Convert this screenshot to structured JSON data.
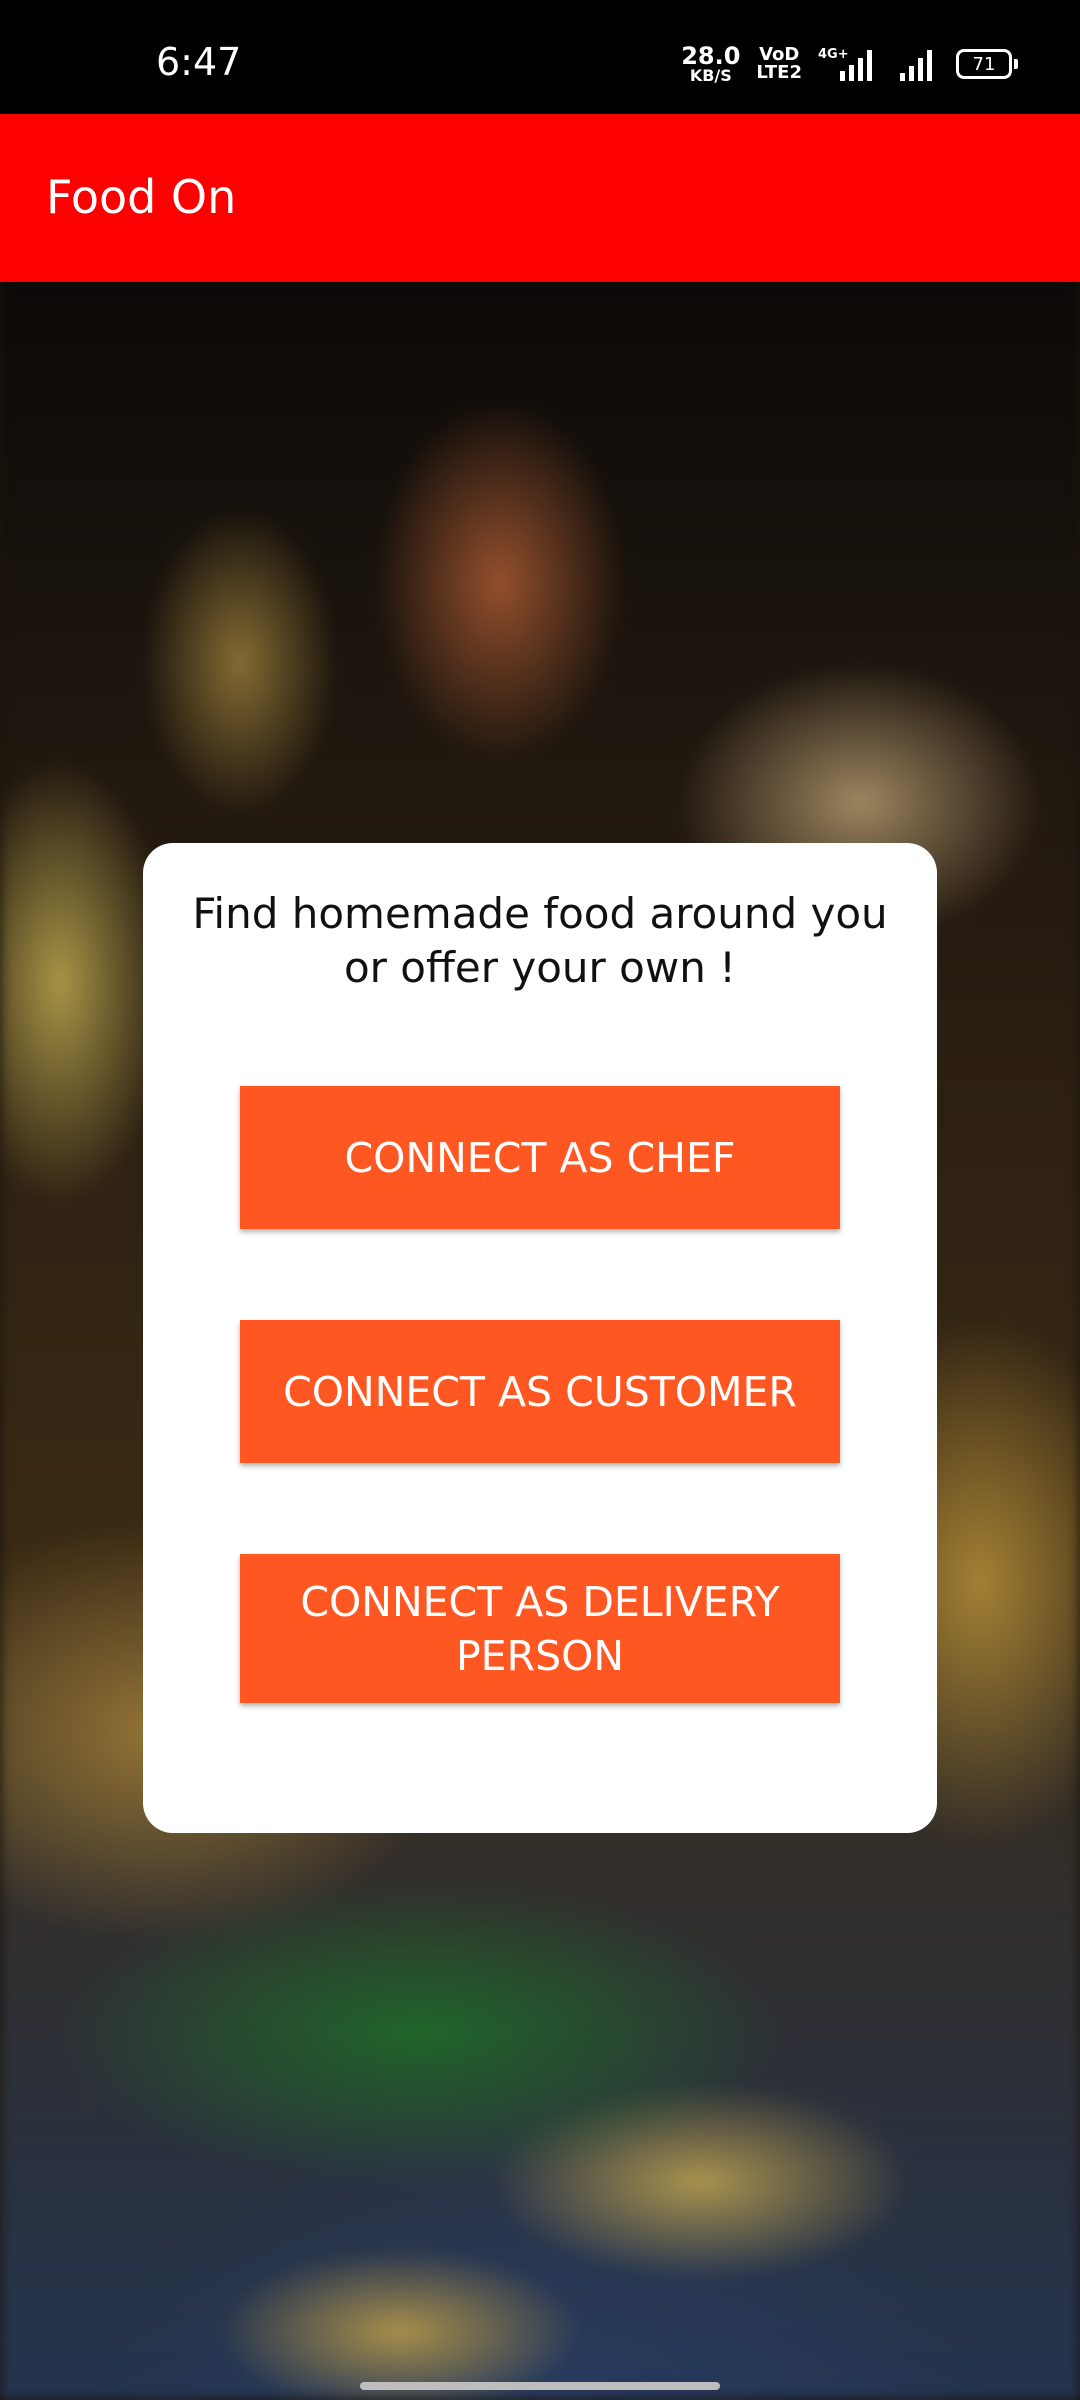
{
  "status_bar": {
    "time": "6:47",
    "net_speed_value": "28.0",
    "net_speed_unit": "KB/S",
    "volte_top": "VoD",
    "volte_bottom": "LTE2",
    "network_type": "4G+",
    "battery_level": "71"
  },
  "app_bar": {
    "title": "Food On"
  },
  "card": {
    "heading_line1": "Find homemade food around you",
    "heading_line2": "or offer your own !"
  },
  "buttons": {
    "chef_label": "CONNECT AS CHEF",
    "customer_label": "CONNECT AS CUSTOMER",
    "delivery_label": "CONNECT AS DELIVERY PERSON"
  },
  "colors": {
    "app_bar": "#ff0000",
    "button": "#ff5722",
    "card": "#ffffff",
    "status_bar": "#000000"
  },
  "icons": {
    "signal_1": "cellular-signal-icon",
    "signal_2": "cellular-signal-icon",
    "battery": "battery-icon",
    "background": "food-background-image"
  }
}
